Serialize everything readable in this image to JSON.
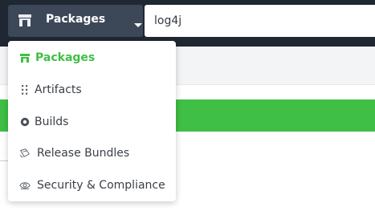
{
  "colors": {
    "topbar": "#1f2733",
    "scope_button": "#3c4757",
    "accent_green": "#3fbf45",
    "text": "#3a3f47"
  },
  "scope_selector": {
    "label": "Packages",
    "icon": "package-icon"
  },
  "search": {
    "value": "log4j"
  },
  "dropdown": {
    "items": [
      {
        "label": "Packages",
        "icon": "package-icon",
        "selected": true
      },
      {
        "label": "Artifacts",
        "icon": "artifacts-icon"
      },
      {
        "label": "Builds",
        "icon": "builds-icon"
      },
      {
        "label": "Release Bundles",
        "icon": "release-bundles-icon"
      },
      {
        "label": "Security & Compliance",
        "icon": "security-compliance-icon"
      }
    ]
  }
}
